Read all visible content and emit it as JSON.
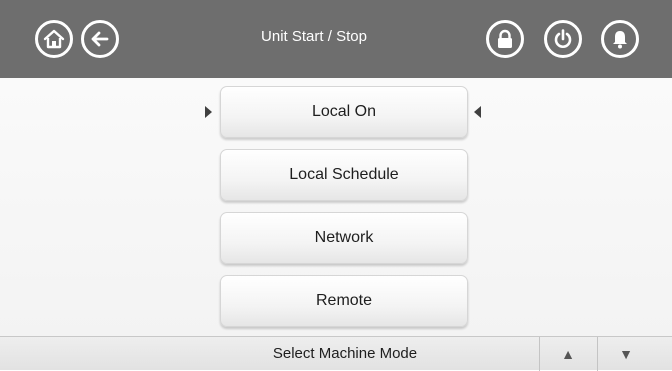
{
  "header": {
    "title": "Unit Start / Stop",
    "icons": [
      "home-icon",
      "back-arrow-icon",
      "lock-icon",
      "power-icon",
      "alarm-bell-icon"
    ],
    "background_color": "#6e6e6e"
  },
  "modes": [
    {
      "label": "Local On",
      "selected": true
    },
    {
      "label": "Local Schedule",
      "selected": false
    },
    {
      "label": "Network",
      "selected": false
    },
    {
      "label": "Remote",
      "selected": false
    }
  ],
  "footer": {
    "label": "Select Machine Mode",
    "up_glyph": "▲",
    "down_glyph": "▼"
  }
}
